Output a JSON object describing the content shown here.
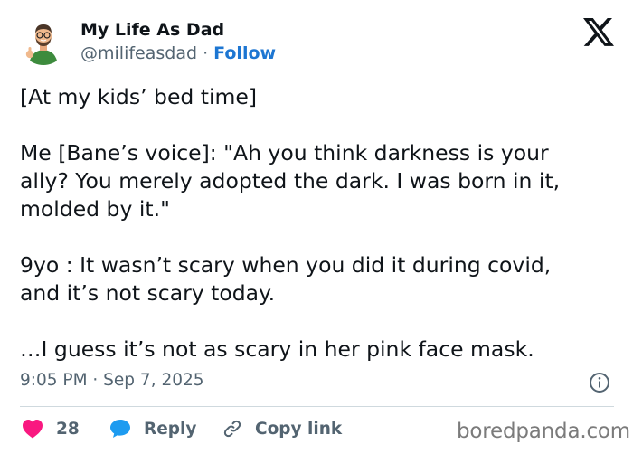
{
  "author": {
    "display_name": "My Life As Dad",
    "handle": "@milifeasdad",
    "separator": "·",
    "follow_label": "Follow"
  },
  "tweet": {
    "paragraphs": [
      "[At my kids’ bed time]",
      "Me [Bane’s voice]: \"Ah you think darkness is your\nally? You merely adopted the dark. I was born in it,\nmolded by it.\"",
      "9yo : It wasn’t scary when you did it during covid,\nand it’s not scary today.",
      "…I guess it’s not as scary in her pink face mask."
    ],
    "timestamp": "9:05 PM · Sep 7, 2025"
  },
  "actions": {
    "like_count": "28",
    "reply_label": "Reply",
    "copy_link_label": "Copy link"
  },
  "watermark": "boredpanda.com",
  "icons": {
    "platform": "x-logo-icon",
    "info": "info-icon",
    "like": "heart-icon",
    "reply": "speech-bubble-icon",
    "copy": "link-icon"
  },
  "colors": {
    "text": "#0f1419",
    "secondary": "#536471",
    "follow": "#1d76d2",
    "heart": "#f91880",
    "reply_bubble": "#1d9bf0",
    "divider": "#cfd9de"
  }
}
